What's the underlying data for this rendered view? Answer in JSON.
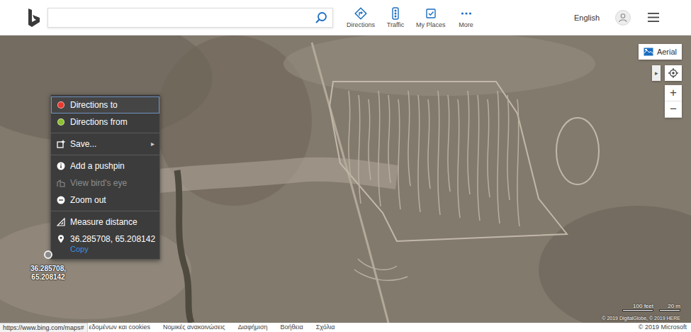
{
  "header": {
    "nav": [
      {
        "label": "Directions"
      },
      {
        "label": "Traffic"
      },
      {
        "label": "My Places"
      },
      {
        "label": "More"
      }
    ],
    "language": "English"
  },
  "map": {
    "style_button": {
      "label": "Aerial"
    },
    "expand_glyph": "▸",
    "zoom": [
      "+",
      "−"
    ],
    "pin": {
      "label_lines": [
        "36.285708,",
        "65.208142"
      ]
    },
    "scale": {
      "imperial": "100 feet",
      "metric": "20 m"
    },
    "attribution": "© 2019 DigitalGlobe, © 2019 HERE"
  },
  "context_menu": {
    "groups": [
      [
        {
          "label": "Directions to",
          "kind": "dot",
          "color": "#e8392f",
          "selected": true,
          "disabled": false
        },
        {
          "label": "Directions from",
          "kind": "dot",
          "color": "#8cbf2f",
          "selected": false,
          "disabled": false
        }
      ],
      [
        {
          "label": "Save...",
          "kind": "submenu",
          "arrow": "▸",
          "selected": false,
          "disabled": false
        }
      ],
      [
        {
          "label": "Add a pushpin",
          "kind": "action",
          "selected": false,
          "disabled": false
        },
        {
          "label": "View bird's eye",
          "kind": "action",
          "selected": false,
          "disabled": true
        },
        {
          "label": "Zoom out",
          "kind": "action",
          "selected": false,
          "disabled": false
        }
      ],
      [
        {
          "label": "Measure distance",
          "kind": "action",
          "selected": false,
          "disabled": false
        },
        {
          "label": "36.285708, 65.208142",
          "kind": "coordinates",
          "link": "Copy",
          "selected": false,
          "disabled": false
        }
      ]
    ]
  },
  "footer": {
    "status_url": "https://www.bing.com/maps#",
    "links": [
      "εδομένων και cookies",
      "Νομικές ανακοινώσεις",
      "Διαφήμιση",
      "Βοήθεια",
      "Σχόλια"
    ],
    "copyright": "© 2019 Microsoft"
  }
}
